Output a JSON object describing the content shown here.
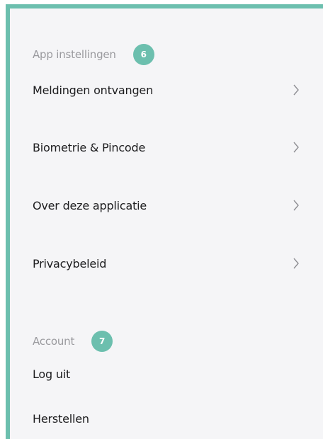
{
  "sections": [
    {
      "label": "App instellingen",
      "badge": "6",
      "items": [
        {
          "label": "Meldingen ontvangen",
          "icon": "chevron-right-icon"
        },
        {
          "label": "Biometrie & Pincode",
          "icon": "chevron-right-icon"
        },
        {
          "label": "Over deze applicatie",
          "icon": "chevron-right-icon"
        },
        {
          "label": "Privacybeleid",
          "icon": "chevron-right-icon"
        }
      ]
    },
    {
      "label": "Account",
      "badge": "7",
      "items": [
        {
          "label": "Log uit"
        },
        {
          "label": "Herstellen"
        }
      ]
    }
  ],
  "colors": {
    "accent": "#6cbfae",
    "background": "#f5f5f7",
    "section_label": "#9a9a9e",
    "item_text": "#1c1c1e"
  }
}
